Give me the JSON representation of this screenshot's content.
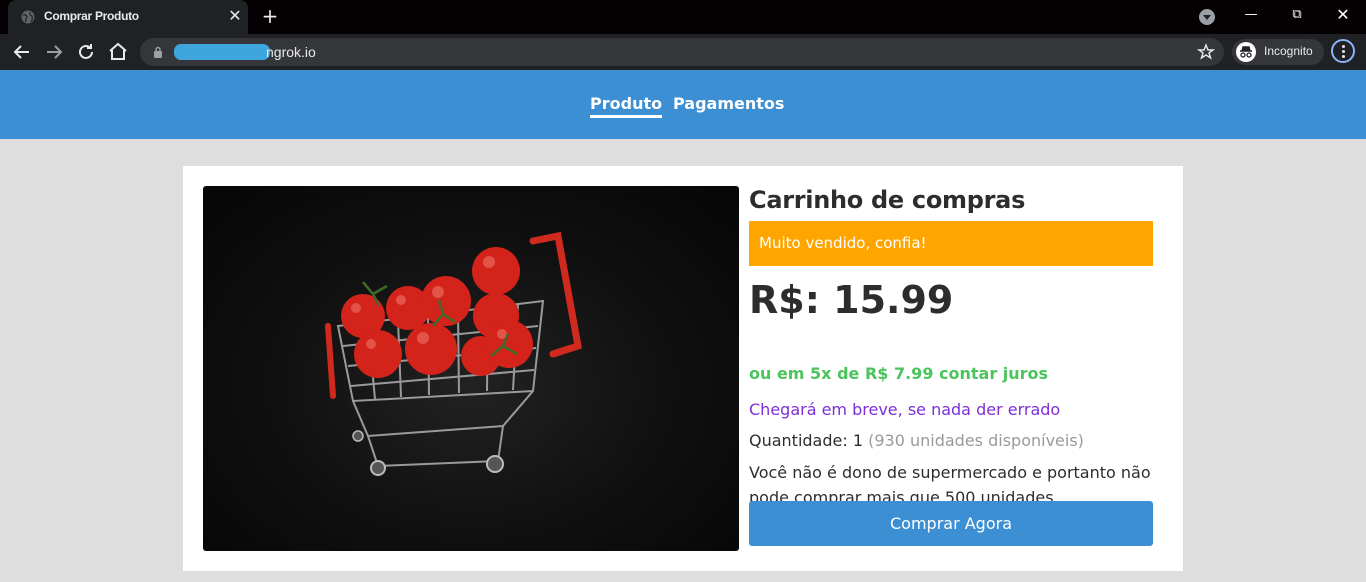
{
  "browser": {
    "tab_title": "Comprar Produto",
    "url": "ngrok.io",
    "incognito_label": "Incognito",
    "icons": {
      "back": "back-arrow-icon",
      "forward": "forward-arrow-icon",
      "reload": "reload-icon",
      "home": "home-icon",
      "lock": "lock-icon",
      "bookmark": "star-icon",
      "menu": "kebab-menu-icon"
    }
  },
  "nav": {
    "links": [
      {
        "label": "Produto",
        "active": true
      },
      {
        "label": "Pagamentos",
        "active": false
      }
    ]
  },
  "product": {
    "title": "Carrinho de compras",
    "badge": "Muito vendido, confia!",
    "price": "R$: 15.99",
    "installments": "ou em 5x de R$ 7.99 contar juros",
    "delivery": "Chegará em breve, se nada der errado",
    "quantity_label": "Quantidade:",
    "quantity_value": "1",
    "availability": "(930 unidades disponíveis)",
    "warning": "Você não é dono de supermercado e portanto não pode comprar mais que 500 unidades",
    "buy_label": "Comprar Agora"
  },
  "colors": {
    "header": "#3d8fd4",
    "badge": "#ffa500",
    "installments": "#4cc45c",
    "delivery": "#7d2fd6",
    "button": "#3d8fd4"
  }
}
